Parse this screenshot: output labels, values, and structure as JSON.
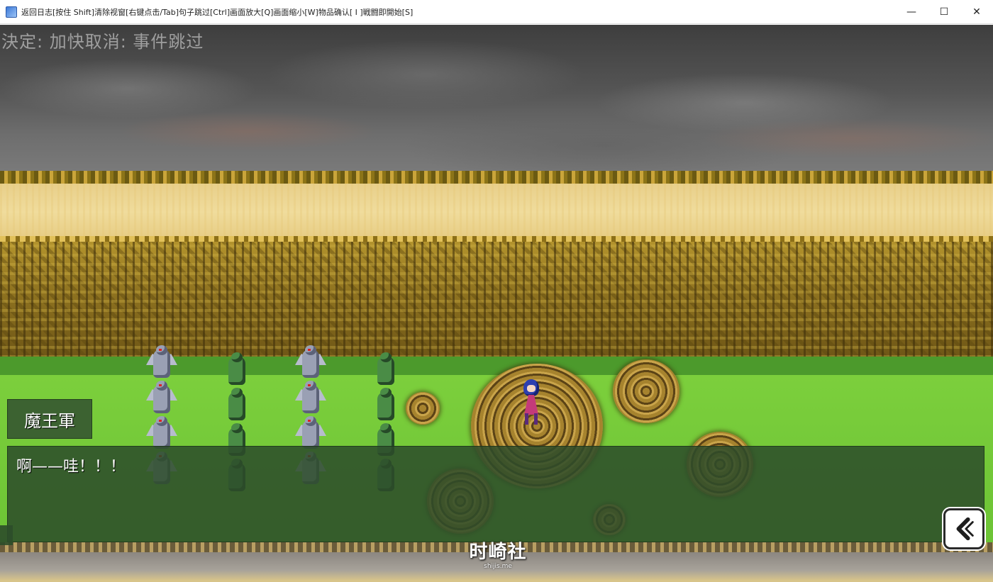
{
  "window": {
    "title": "返回日志[按住 Shift]清除视窗[右键点击/Tab]句子跳过[Ctrl]画面放大[Q]画面缩小[W]物品确认[ I ]戦闘即開始[S]",
    "minimize_glyph": "—",
    "maximize_glyph": "☐",
    "close_glyph": "✕"
  },
  "game": {
    "hint": "決定: 加快取消: 事件跳过",
    "speaker": "魔王軍",
    "message": "啊——哇！！！"
  },
  "watermark": {
    "main": "时崎社",
    "sub": "shijis.me"
  },
  "icons": {
    "app": "app-icon",
    "back": "back-arrow-icon"
  }
}
